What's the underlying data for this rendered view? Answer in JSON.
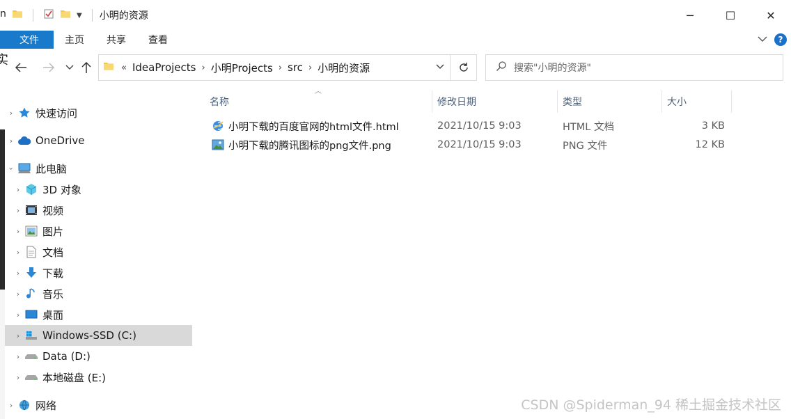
{
  "window": {
    "title": "小明的资源",
    "controls": {
      "minimize": "─",
      "maximize": "☐",
      "close": "✕"
    }
  },
  "ribbon": {
    "tabs": [
      "文件",
      "主页",
      "共享",
      "查看"
    ],
    "expand_icon": "chevron-down",
    "help_label": "?"
  },
  "address_bar": {
    "overflow": "«",
    "crumbs": [
      "IdeaProjects",
      "小明Projects",
      "src",
      "小明的资源"
    ]
  },
  "search": {
    "placeholder": "搜索\"小明的资源\""
  },
  "nav": {
    "items": [
      {
        "label": "快速访问",
        "icon": "star-icon"
      },
      {
        "label": "OneDrive",
        "icon": "cloud-icon"
      },
      {
        "label": "此电脑",
        "icon": "computer-icon"
      },
      {
        "label": "3D 对象",
        "icon": "cube-icon"
      },
      {
        "label": "视频",
        "icon": "film-icon"
      },
      {
        "label": "图片",
        "icon": "picture-icon"
      },
      {
        "label": "文档",
        "icon": "document-icon"
      },
      {
        "label": "下载",
        "icon": "download-arrow-icon"
      },
      {
        "label": "音乐",
        "icon": "music-note-icon"
      },
      {
        "label": "桌面",
        "icon": "desktop-icon"
      },
      {
        "label": "Windows-SSD (C:)",
        "icon": "windows-drive-icon"
      },
      {
        "label": "Data (D:)",
        "icon": "drive-icon"
      },
      {
        "label": "本地磁盘 (E:)",
        "icon": "drive-icon"
      },
      {
        "label": "网络",
        "icon": "network-icon"
      }
    ]
  },
  "columns": {
    "name": "名称",
    "modified": "修改日期",
    "type": "类型",
    "size": "大小"
  },
  "files": [
    {
      "name": "小明下载的百度官网的html文件.html",
      "modified": "2021/10/15 9:03",
      "type": "HTML 文档",
      "size": "3 KB",
      "icon": "html-file-icon"
    },
    {
      "name": "小明下载的腾讯图标的png文件.png",
      "modified": "2021/10/15 9:03",
      "type": "PNG 文件",
      "size": "12 KB",
      "icon": "png-file-icon"
    }
  ],
  "watermark": "CSDN @Spiderman_94    稀土掘金技术社区",
  "colors": {
    "accent": "#1979ca",
    "selected_bg": "#d9d9d9",
    "folder": "#f3c74a"
  }
}
